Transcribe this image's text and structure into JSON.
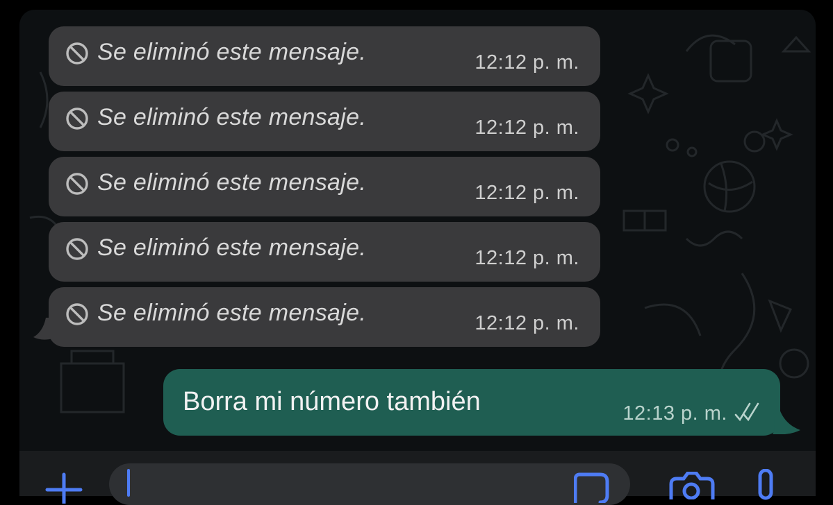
{
  "colors": {
    "chat_background": "#0d1012",
    "incoming_bubble": "#3a3a3c",
    "outgoing_bubble": "#1f5e52",
    "input_bar": "#1a1c1e",
    "composer": "#2e3033",
    "caret": "#4e7cf4"
  },
  "messages": [
    {
      "direction": "incoming",
      "icon": "deleted-message-ban-icon",
      "text": "Se eliminó este mensaje.",
      "time": "12:12 p. m."
    },
    {
      "direction": "incoming",
      "icon": "deleted-message-ban-icon",
      "text": "Se eliminó este mensaje.",
      "time": "12:12 p. m."
    },
    {
      "direction": "incoming",
      "icon": "deleted-message-ban-icon",
      "text": "Se eliminó este mensaje.",
      "time": "12:12 p. m."
    },
    {
      "direction": "incoming",
      "icon": "deleted-message-ban-icon",
      "text": "Se eliminó este mensaje.",
      "time": "12:12 p. m."
    },
    {
      "direction": "incoming",
      "icon": "deleted-message-ban-icon",
      "text": "Se eliminó este mensaje.",
      "time": "12:12 p. m."
    },
    {
      "direction": "outgoing",
      "text": "Borra mi número también",
      "time": "12:13 p. m.",
      "status_icon": "double-check-icon"
    }
  ],
  "input_bar": {
    "message_value": "",
    "icons": [
      "plus-icon",
      "sticker-icon",
      "camera-icon",
      "microphone-icon"
    ]
  }
}
